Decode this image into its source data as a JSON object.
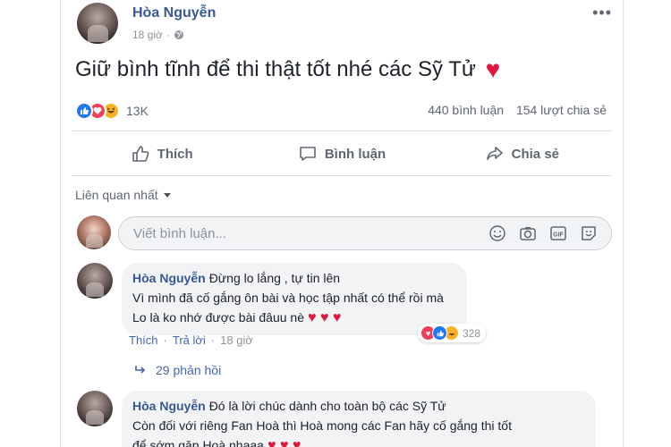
{
  "post": {
    "author": "Hòa Nguyễn",
    "time": "18 giờ",
    "text": "Giữ bình tĩnh để thi thật tốt nhé các Sỹ Tử",
    "heart": "♥",
    "more": "•••",
    "reaction_count": "13K",
    "comments_count": "440 bình luận",
    "shares_count": "154 lượt chia sẻ"
  },
  "actions": {
    "like": "Thích",
    "comment": "Bình luận",
    "share": "Chia sẻ"
  },
  "comments_section": {
    "sort_label": "Liên quan nhất",
    "composer_placeholder": "Viết bình luận..."
  },
  "comments": [
    {
      "author": "Hòa Nguyễn",
      "line1": "Đừng lo lắng , tự tin lên",
      "line2": "Vì mình đã cố gắng ôn bài và học tập nhất có thể rồi mà",
      "line3": "Lo là ko nhớ được bài đâuu nè",
      "hearts": "♥ ♥ ♥",
      "like_label": "Thích",
      "reply_label": "Trả lời",
      "time": "18 giờ",
      "reaction_count": "328",
      "replies": "29 phản hồi"
    },
    {
      "author": "Hòa Nguyễn",
      "line1": "Đó là lời chúc dành cho toàn bộ các Sỹ Tử",
      "line2": "Còn đối với riêng Fan Hoà thì Hoà mong các Fan hãy cố gắng thi tốt",
      "line3": "để sớm gặp Hoà nhaaa",
      "hearts": "♥ ♥ ♥"
    }
  ],
  "colors": {
    "link": "#385898",
    "like_blue": "#2078f4",
    "love_red": "#f33e58",
    "haha_yellow": "#f7b125",
    "heart": "#e0173d"
  },
  "icons": [
    "globe-icon",
    "more-icon",
    "like-icon",
    "comment-icon",
    "share-icon",
    "emoji-icon",
    "camera-icon",
    "gif-icon",
    "sticker-icon",
    "reply-arrow-icon"
  ]
}
